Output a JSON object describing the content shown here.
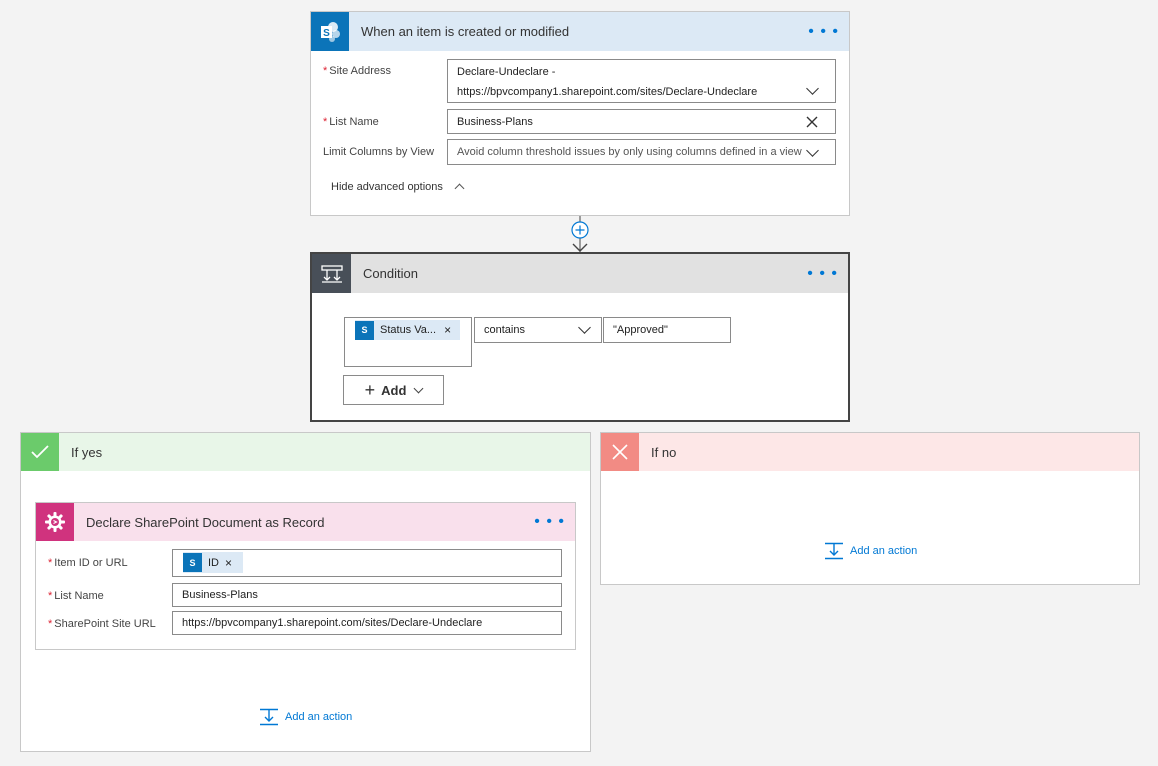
{
  "trigger": {
    "title": "When an item is created or modified",
    "icon": "sharepoint-icon",
    "site_address_label": "Site Address",
    "site_address_line1": "Declare-Undeclare -",
    "site_address_line2": "https://bpvcompany1.sharepoint.com/sites/Declare-Undeclare",
    "list_name_label": "List Name",
    "list_name_value": "Business-Plans",
    "limit_columns_label": "Limit Columns by View",
    "limit_columns_value": "Avoid column threshold issues by only using columns defined in a view",
    "hide_advanced": "Hide advanced options"
  },
  "condition": {
    "title": "Condition",
    "token_label": "Status Va...",
    "operator": "contains",
    "value": "\"Approved\"",
    "add_label": "Add"
  },
  "if_yes": {
    "title": "If yes",
    "action": {
      "title": "Declare SharePoint Document as Record",
      "item_id_label": "Item ID or URL",
      "item_id_token": "ID",
      "list_name_label": "List Name",
      "list_name_value": "Business-Plans",
      "site_url_label": "SharePoint Site URL",
      "site_url_value": "https://bpvcompany1.sharepoint.com/sites/Declare-Undeclare"
    },
    "add_action": "Add an action"
  },
  "if_no": {
    "title": "If no",
    "add_action": "Add an action"
  },
  "colors": {
    "sharepoint": "#0b74b9",
    "trigger_header": "#dce9f5",
    "condition_header": "#e1e1e1",
    "condition_icon_bg": "#484f58",
    "yes_header": "#e8f6e8",
    "yes_icon_bg": "#6bcb6b",
    "no_header": "#fde7e7",
    "no_icon_bg": "#f28b84",
    "action_header": "#f9e0ec",
    "action_icon_bg": "#d0337e",
    "link": "#0078d4"
  }
}
